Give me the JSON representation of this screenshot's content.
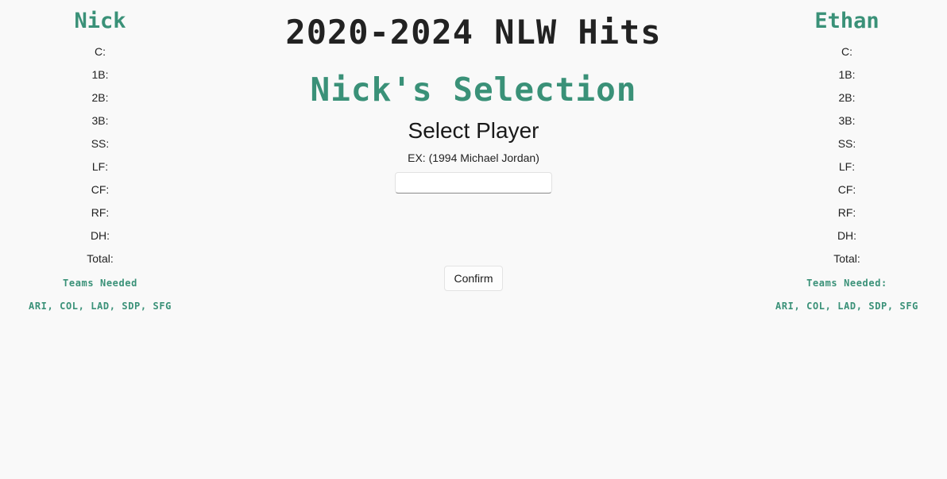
{
  "left_player": {
    "name": "Nick",
    "positions": [
      "C:",
      "1B:",
      "2B:",
      "3B:",
      "SS:",
      "LF:",
      "CF:",
      "RF:",
      "DH:",
      "Total:"
    ],
    "teams_label": "Teams Needed",
    "teams": "ARI, COL, LAD, SDP, SFG"
  },
  "right_player": {
    "name": "Ethan",
    "positions": [
      "C:",
      "1B:",
      "2B:",
      "3B:",
      "SS:",
      "LF:",
      "CF:",
      "RF:",
      "DH:",
      "Total:"
    ],
    "teams_label": "Teams Needed:",
    "teams": "ARI, COL, LAD, SDP, SFG"
  },
  "main": {
    "title": "2020-2024 NLW Hits",
    "selection_title": "Nick's Selection",
    "select_heading": "Select Player",
    "example": "EX: (1994 Michael Jordan)",
    "input_value": "",
    "input_placeholder": "",
    "confirm_label": "Confirm"
  },
  "colors": {
    "accent": "#3a9178",
    "background": "#f9f9f9",
    "text": "#222222"
  }
}
